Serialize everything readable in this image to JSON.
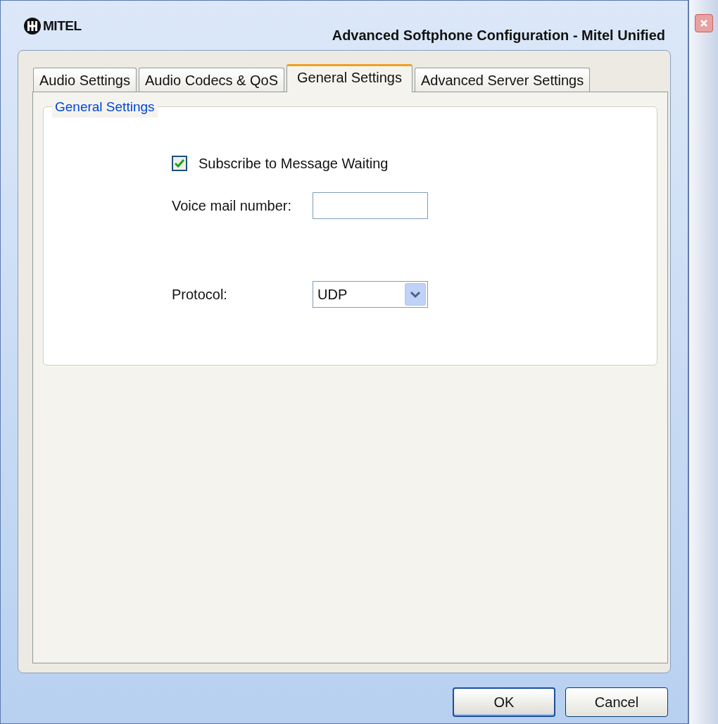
{
  "window": {
    "logo": "MITEL",
    "title": "Advanced Softphone Configuration - Mitel Unified"
  },
  "tabs": [
    {
      "label": "Audio Settings",
      "selected": false
    },
    {
      "label": "Audio Codecs & QoS",
      "selected": false
    },
    {
      "label": "General Settings",
      "selected": true
    },
    {
      "label": "Advanced Server Settings",
      "selected": false
    }
  ],
  "group": {
    "title": "General Settings",
    "subscribe": {
      "label": "Subscribe to Message Waiting",
      "checked": true
    },
    "voicemail": {
      "label": "Voice mail number:"
    },
    "protocol": {
      "label": "Protocol:",
      "value": "UDP"
    }
  },
  "buttons": [
    {
      "label": "OK",
      "default": true
    },
    {
      "label": "Cancel",
      "default": false
    }
  ]
}
